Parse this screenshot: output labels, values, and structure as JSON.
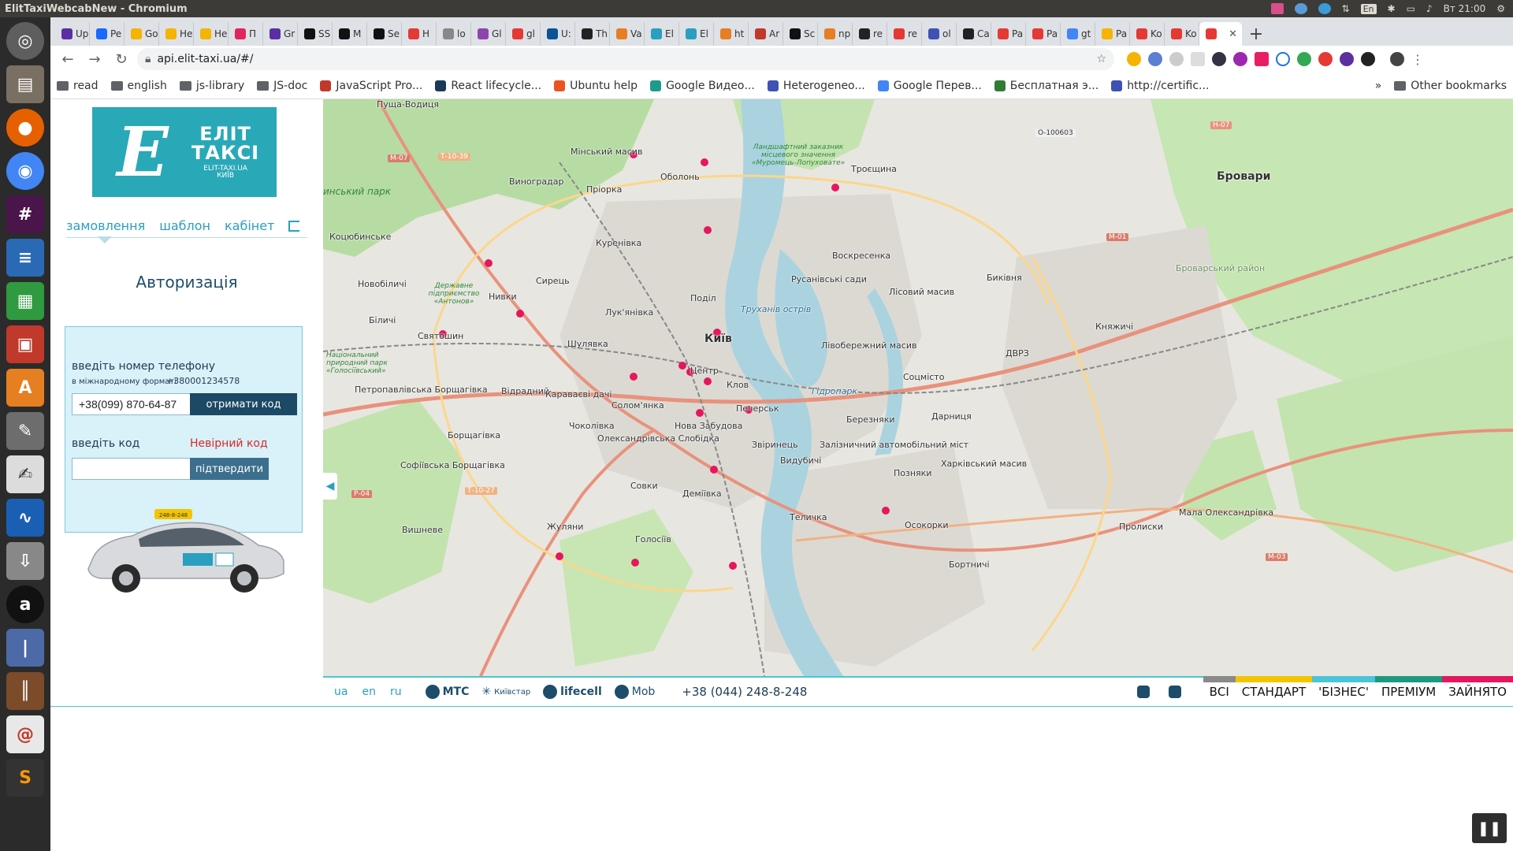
{
  "os": {
    "window_title": "ElitTaxiWebcabNew - Chromium",
    "clock": "Вт 21:00",
    "keyboard_layout": "En"
  },
  "launcher": {
    "icons": [
      "files-icon",
      "firefox-icon",
      "chromium-icon",
      "slack-icon",
      "writer-icon",
      "calc-icon",
      "impress-icon",
      "software-center-icon",
      "settings-icon",
      "text-editor-icon",
      "system-monitor-icon",
      "disk-icon",
      "amazon-icon",
      "thermometer-icon",
      "library-icon",
      "mail-icon",
      "sublime-icon"
    ]
  },
  "browser": {
    "tabs": [
      {
        "label": "Up",
        "color": "#5b2fa0"
      },
      {
        "label": "Pe",
        "color": "#1769ff"
      },
      {
        "label": "Go",
        "color": "#f4b400"
      },
      {
        "label": "He",
        "color": "#f4b400"
      },
      {
        "label": "He",
        "color": "#f4b400"
      },
      {
        "label": "П",
        "color": "#e0245e"
      },
      {
        "label": "Gr",
        "color": "#5b2fa0"
      },
      {
        "label": "SS",
        "color": "#111111"
      },
      {
        "label": "M",
        "color": "#111111"
      },
      {
        "label": "Se",
        "color": "#111111"
      },
      {
        "label": "H",
        "color": "#e53935"
      },
      {
        "label": "lo",
        "color": "#888888"
      },
      {
        "label": "Gl",
        "color": "#8e44ad"
      },
      {
        "label": "gl",
        "color": "#e53935"
      },
      {
        "label": "U:",
        "color": "#0b5394"
      },
      {
        "label": "Th",
        "color": "#222222"
      },
      {
        "label": "Va",
        "color": "#e67e22"
      },
      {
        "label": "El",
        "color": "#2a9fbf"
      },
      {
        "label": "El",
        "color": "#2a9fbf"
      },
      {
        "label": "ht",
        "color": "#e67e22"
      },
      {
        "label": "Ar",
        "color": "#c0392b"
      },
      {
        "label": "Sc",
        "color": "#111111"
      },
      {
        "label": "np",
        "color": "#e67e22"
      },
      {
        "label": "re",
        "color": "#222222"
      },
      {
        "label": "re",
        "color": "#e53935"
      },
      {
        "label": "ol",
        "color": "#3f51b5"
      },
      {
        "label": "Ca",
        "color": "#222222"
      },
      {
        "label": "Pa",
        "color": "#e53935"
      },
      {
        "label": "Pa",
        "color": "#e53935"
      },
      {
        "label": "gt",
        "color": "#4285f4"
      },
      {
        "label": "Pa",
        "color": "#f4b400"
      },
      {
        "label": "Ko",
        "color": "#e53935"
      },
      {
        "label": "Ko",
        "color": "#e53935"
      }
    ],
    "active_tab_label": "",
    "active_tab_color": "#e53935",
    "url": "api.elit-taxi.ua/#/",
    "bookmarks": [
      {
        "label": "read",
        "type": "folder"
      },
      {
        "label": "english",
        "type": "folder"
      },
      {
        "label": "js-library",
        "type": "folder"
      },
      {
        "label": "JS-doc",
        "type": "folder"
      },
      {
        "label": "JavaScript Pro...",
        "type": "site",
        "color": "#c0392b"
      },
      {
        "label": "React lifecycle...",
        "type": "site",
        "color": "#1b3a57"
      },
      {
        "label": "Ubuntu help",
        "type": "site",
        "color": "#e95420"
      },
      {
        "label": "Google Видео...",
        "type": "site",
        "color": "#1f9b8b"
      },
      {
        "label": "Heterogeneo...",
        "type": "site",
        "color": "#3f51b5"
      },
      {
        "label": "Google Перев...",
        "type": "site",
        "color": "#4285f4"
      },
      {
        "label": "Бесплатная э...",
        "type": "site",
        "color": "#2e7d32"
      },
      {
        "label": "http://certific...",
        "type": "site",
        "color": "#3f51b5"
      }
    ],
    "other_bookmarks": "Other bookmarks",
    "overflow": "»"
  },
  "app": {
    "logo": {
      "mark": "E",
      "word1": "ЕЛІТ",
      "word2": "ТАКСІ",
      "site": "ELIT-TAXI.UA",
      "city": "КИЇВ"
    },
    "menu": {
      "order": "замовлення",
      "template": "шаблон",
      "cabinet": "кабінет"
    },
    "auth": {
      "title": "Авторизація",
      "phone_label": "введіть номер телефону",
      "format_hint": "в міжнародному форматі",
      "format_example": "+380001234578",
      "phone_value": "+38(099) 870-64-87",
      "get_code": "отримати код",
      "code_label": "введіть код",
      "code_error": "Невірний код",
      "code_value": "",
      "confirm": "підтвердити"
    },
    "car_badge": "248-8-248"
  },
  "map": {
    "places": [
      {
        "name": "Київ",
        "big": true
      },
      {
        "name": "Бровари",
        "big": true
      },
      {
        "name": "Оболонь"
      },
      {
        "name": "Виноградар"
      },
      {
        "name": "Мінський масив"
      },
      {
        "name": "Пріорка"
      },
      {
        "name": "Троєщина"
      },
      {
        "name": "Куренівка"
      },
      {
        "name": "Коцюбинське"
      },
      {
        "name": "Новобіличі"
      },
      {
        "name": "Нивки"
      },
      {
        "name": "Сирець"
      },
      {
        "name": "Лук'янівка"
      },
      {
        "name": "Поділ"
      },
      {
        "name": "Воскресенка"
      },
      {
        "name": "Русанівські сади"
      },
      {
        "name": "Лісовий масив"
      },
      {
        "name": "Биківня"
      },
      {
        "name": "Біличі"
      },
      {
        "name": "Святошин"
      },
      {
        "name": "Шулявка"
      },
      {
        "name": "Центр"
      },
      {
        "name": "Лівобережний масив"
      },
      {
        "name": "Соцмісто"
      },
      {
        "name": "ДВРЗ"
      },
      {
        "name": "Петропавлівська Борщагівка"
      },
      {
        "name": "Відрадний"
      },
      {
        "name": "Караваєві дачі"
      },
      {
        "name": "Солом'янка"
      },
      {
        "name": "Клов"
      },
      {
        "name": "Печерськ"
      },
      {
        "name": "Березняки"
      },
      {
        "name": "Дарниця"
      },
      {
        "name": "Чоколівка"
      },
      {
        "name": "Нова Забудова"
      },
      {
        "name": "Борщагівка"
      },
      {
        "name": "Олександрівська Слобідка"
      },
      {
        "name": "Звіринець"
      },
      {
        "name": "Видубичі"
      },
      {
        "name": "Залізничний автомобільний міст"
      },
      {
        "name": "Харківський масив"
      },
      {
        "name": "Позняки"
      },
      {
        "name": "Софіївська Борщагівка"
      },
      {
        "name": "Совки"
      },
      {
        "name": "Деміївка"
      },
      {
        "name": "Теличка"
      },
      {
        "name": "Осокорки"
      },
      {
        "name": "Вишневе"
      },
      {
        "name": "Жуляни"
      },
      {
        "name": "Голосіїв"
      },
      {
        "name": "Бортничі"
      },
      {
        "name": "Княжичі"
      },
      {
        "name": "Пролиски"
      },
      {
        "name": "Мала Олександрівка"
      },
      {
        "name": "Пуща-Водиця"
      },
      {
        "name": "Броварський район"
      },
      {
        "name": "Гідропарк"
      },
      {
        "name": "Труханів острів"
      }
    ],
    "roads": [
      "М-07",
      "Т-10-39",
      "О-100603",
      "Н-07",
      "М-01",
      "Р-04",
      "Т-10-27",
      "М-03"
    ],
    "green_labels": [
      "Ландшафтний заказник місцевого значення «Муромець-Лопуховате»",
      "Державне підприємство «Антонов»",
      "Національний природний парк «Голосіївський»",
      "инський парк"
    ],
    "toggle": "◀"
  },
  "footer": {
    "langs": [
      "ua",
      "en",
      "ru"
    ],
    "operators": [
      "МТС",
      "Київстар",
      "lifecell",
      "Mob"
    ],
    "phone": "+38 (044) 248-8-248",
    "classes": [
      {
        "label": "ВСІ",
        "color": "#8a8a8a"
      },
      {
        "label": "СТАНДАРТ",
        "color": "#f2c500"
      },
      {
        "label": "'БІЗНЕС'",
        "color": "#4cc4d8"
      },
      {
        "label": "ПРЕМІУМ",
        "color": "#1b9a7f"
      },
      {
        "label": "ЗАЙНЯТО",
        "color": "#e5175e"
      }
    ]
  }
}
